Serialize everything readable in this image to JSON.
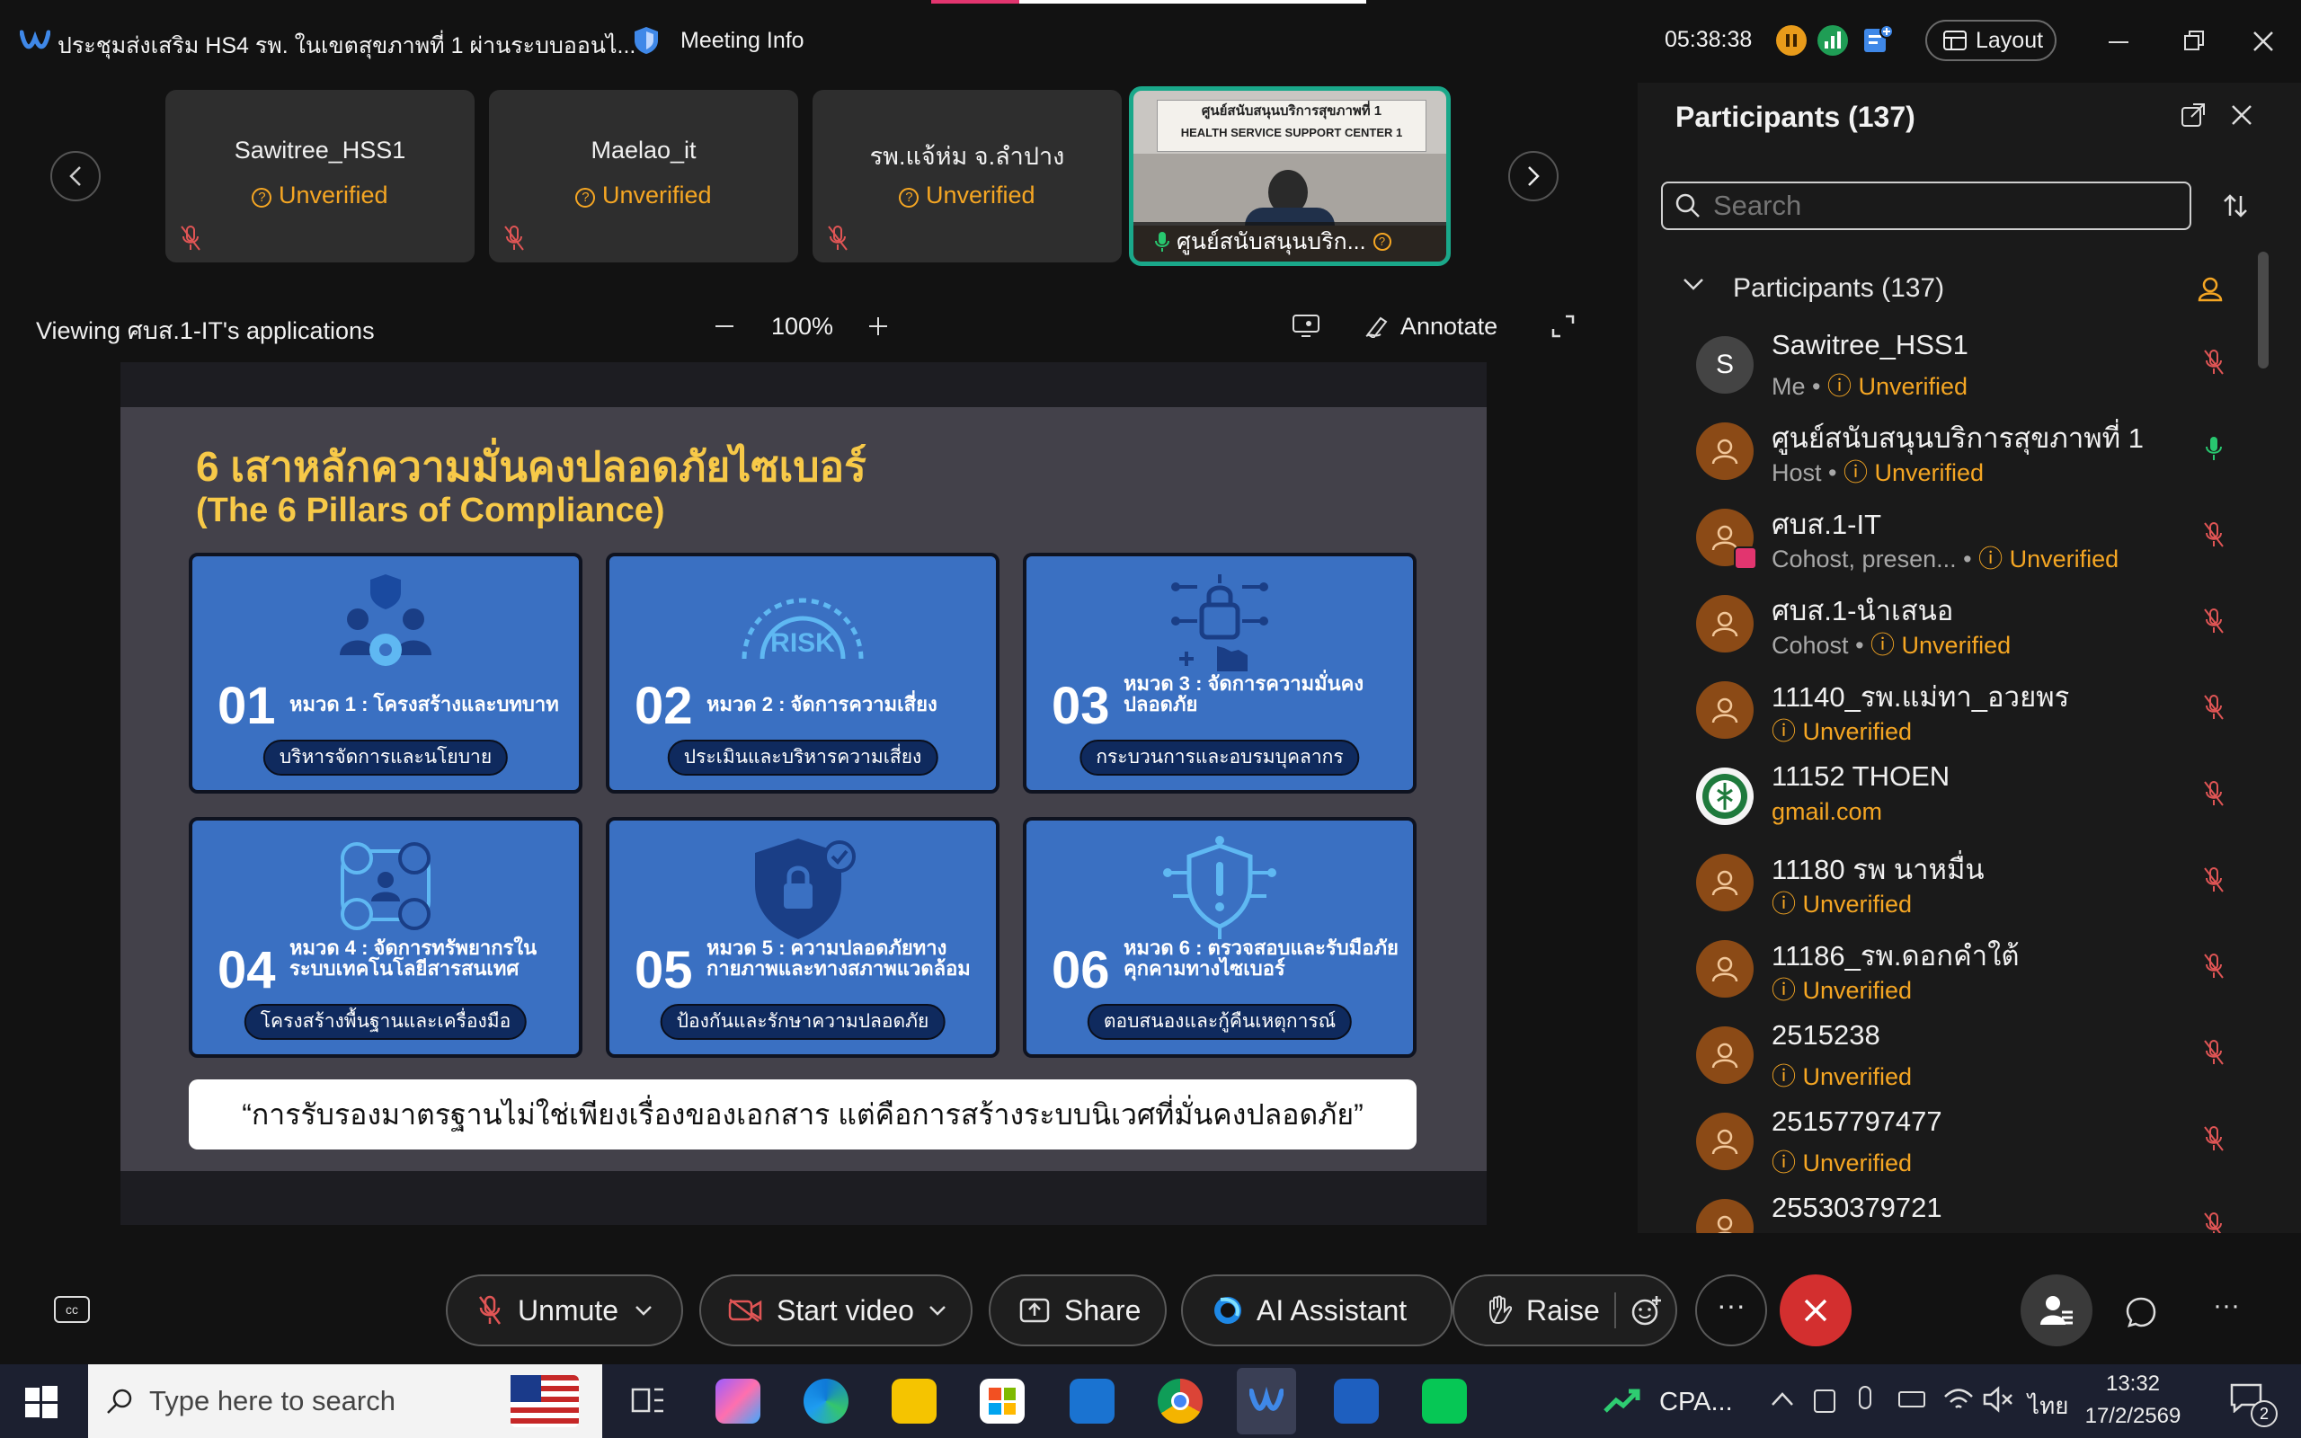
{
  "titlebar": {
    "meeting_title": "ประชุมส่งเสริม HS4 รพ. ในเขตสุขภาพที่ 1 ผ่านระบบออนไ...",
    "meeting_info": "Meeting Info",
    "time": "05:38:38",
    "layout_label": "Layout"
  },
  "thumbnails": [
    {
      "name": "Sawitree_HSS1",
      "status": "Unverified"
    },
    {
      "name": "Maelao_it",
      "status": "Unverified"
    },
    {
      "name": "รพ.แจ้ห่ม จ.ลำปาง",
      "status": "Unverified"
    },
    {
      "name": "ศูนย์สนับสนุนบริก...",
      "video_banner_line1": "ศูนย์สนับสนุนบริการสุขภาพที่ 1",
      "video_banner_line2": "HEALTH SERVICE SUPPORT CENTER 1"
    }
  ],
  "share": {
    "viewing_label": "Viewing ศบส.1-IT's applications",
    "zoom": "100%",
    "annotate_label": "Annotate"
  },
  "slide": {
    "title_line1": "6 เสาหลักความมั่นคงปลอดภัยไซเบอร์",
    "title_line2": "(The 6 Pillars of Compliance)",
    "cards": [
      {
        "num": "01",
        "title": "หมวด 1 : โครงสร้างและบทบาท",
        "pill": "บริหารจัดการและนโยบาย"
      },
      {
        "num": "02",
        "title": "หมวด 2 : จัดการความเสี่ยง",
        "pill": "ประเมินและบริหารความเสี่ยง",
        "icon_text": "RISK"
      },
      {
        "num": "03",
        "title": "หมวด 3 : จัดการความมั่นคงปลอดภัย",
        "pill": "กระบวนการและอบรมบุคลากร"
      },
      {
        "num": "04",
        "title": "หมวด 4 : จัดการทรัพยากรในระบบเทคโนโลยีสารสนเทศ",
        "pill": "โครงสร้างพื้นฐานและเครื่องมือ"
      },
      {
        "num": "05",
        "title": "หมวด 5 : ความปลอดภัยทางกายภาพและทางสภาพแวดล้อม",
        "pill": "ป้องกันและรักษาความปลอดภัย"
      },
      {
        "num": "06",
        "title": "หมวด 6 : ตรวจสอบและรับมือภัยคุกคามทางไซเบอร์",
        "pill": "ตอบสนองและกู้คืนเหตุการณ์"
      }
    ],
    "quote": "“การรับรองมาตรฐานไม่ใช่เพียงเรื่องของเอกสาร แต่คือการสร้างระบบนิเวศที่มั่นคงปลอดภัย”"
  },
  "panel": {
    "header": "Participants (137)",
    "search_placeholder": "Search",
    "group_label": "Participants (137)",
    "participants": [
      {
        "name": "Sawitree_HSS1",
        "role": "Me",
        "status": "Unverified",
        "avatar_letter": "S"
      },
      {
        "name": "ศูนย์สนับสนุนบริการสุขภาพที่ 1",
        "role": "Host",
        "status": "Unverified"
      },
      {
        "name": "ศบส.1-IT",
        "role": "Cohost, presen...",
        "status": "Unverified"
      },
      {
        "name": "ศบส.1-นำเสนอ",
        "role": "Cohost",
        "status": "Unverified"
      },
      {
        "name": "11140_รพ.แม่ทา_อวยพร",
        "role": "",
        "status": "Unverified"
      },
      {
        "name": "11152 THOEN",
        "role": "",
        "status": "gmail.com"
      },
      {
        "name": "11180 รพ นาหมื่น",
        "role": "",
        "status": "Unverified"
      },
      {
        "name": "11186_รพ.ดอกคำใต้",
        "role": "",
        "status": "Unverified"
      },
      {
        "name": "2515238",
        "role": "",
        "status": "Unverified"
      },
      {
        "name": "25157797477",
        "role": "",
        "status": "Unverified"
      },
      {
        "name": "25530379721",
        "role": "",
        "status": ""
      }
    ]
  },
  "controls": {
    "unmute": "Unmute",
    "start_video": "Start video",
    "share": "Share",
    "ai_assistant": "AI Assistant",
    "raise": "Raise"
  },
  "taskbar": {
    "search_placeholder": "Type here to search",
    "stock_label": "CPA...",
    "language": "ไทย",
    "time": "13:32",
    "date": "17/2/2569",
    "notification_count": "2"
  },
  "colors": {
    "accent_orange": "#f5a623",
    "end_red": "#d32f2f",
    "card_blue": "#3a70c2",
    "slide_title_yellow": "#f7c948"
  }
}
